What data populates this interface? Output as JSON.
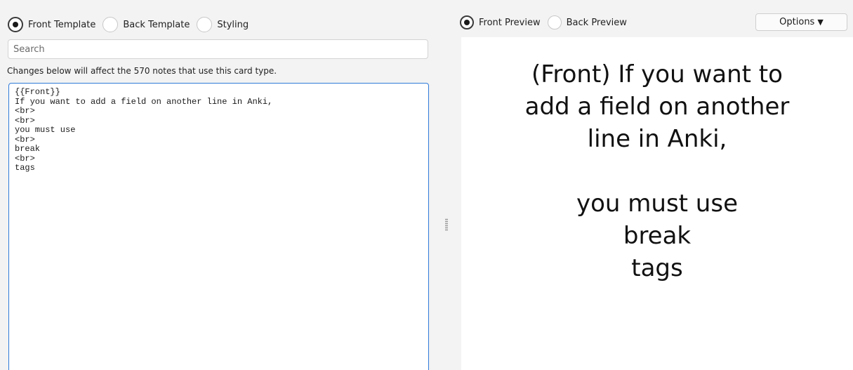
{
  "left": {
    "tabs": [
      {
        "label": "Front Template",
        "checked": true
      },
      {
        "label": "Back Template",
        "checked": false
      },
      {
        "label": "Styling",
        "checked": false
      }
    ],
    "search_placeholder": "Search",
    "notice": "Changes below will affect the 570 notes that use this card type.",
    "editor_lines": [
      "{{Front}}",
      "If you want to add a field on another line in Anki,",
      "<br>",
      "<br>",
      "you must use",
      "<br>",
      "break",
      "<br>",
      "tags"
    ]
  },
  "right": {
    "tabs": [
      {
        "label": "Front Preview",
        "checked": true
      },
      {
        "label": "Back Preview",
        "checked": false
      }
    ],
    "options_label": "Options",
    "options_arrow": "▼",
    "preview_lines": [
      "(Front) If you want to",
      "add a field on another",
      "line in Anki,",
      "",
      "you must use",
      "break",
      "tags"
    ]
  },
  "icons": {
    "radio": "radio-button-icon",
    "options_arrow": "triangle-down-icon",
    "splitter": "splitter-grip-icon"
  },
  "colors": {
    "editor_focus_border": "#2f7bd9",
    "background": "#f3f3f3"
  }
}
